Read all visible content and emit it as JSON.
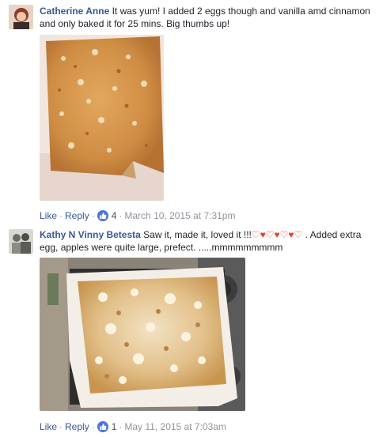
{
  "comments": [
    {
      "author": "Catherine Anne",
      "text": "It was yum! I added 2 eggs though and vanilla amd cinnamon and only baked it for 25 mins. Big thumbs up!",
      "actions": {
        "like": "Like",
        "reply": "Reply",
        "reaction_count": "4",
        "timestamp": "March 10, 2015 at 7:31pm"
      }
    },
    {
      "author": "Kathy N Vinny Betesta",
      "text_start": "Saw it, made it, loved it !!!",
      "hearts": "♡♥♡♥♡♥♡",
      "text_end": " . Added extra egg, apples were quite large, prefect. .....mmmmmmmmm",
      "actions": {
        "like": "Like",
        "reply": "Reply",
        "reaction_count": "1",
        "timestamp": "May 11, 2015 at 7:03am"
      }
    }
  ],
  "icons": {
    "reaction": "thumbs-up-icon"
  },
  "colors": {
    "link": "#365899",
    "meta": "#90949c",
    "like_badge": "#4a76d9",
    "heart": "#e0462a"
  }
}
